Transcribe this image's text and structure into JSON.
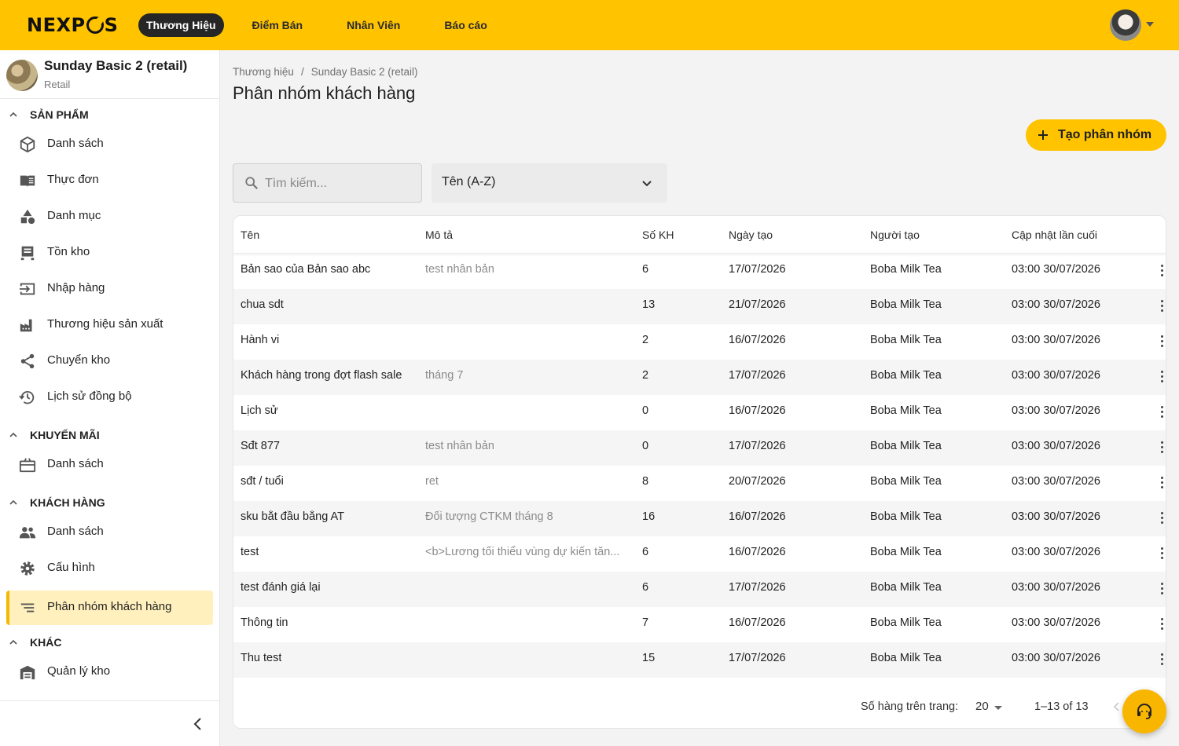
{
  "topbar": {
    "logo_text": "NEXPOS",
    "nav": [
      "Thương Hiệu",
      "Điểm Bán",
      "Nhân Viên",
      "Báo cáo"
    ],
    "active_nav_index": 0
  },
  "brand": {
    "name": "Sunday Basic 2 (retail)",
    "subtitle": "Retail"
  },
  "sidebar": {
    "sections": [
      {
        "title": "SẢN PHẨM",
        "items": [
          {
            "label": "Danh sách",
            "icon": "box-icon"
          },
          {
            "label": "Thực đơn",
            "icon": "menu-book-icon"
          },
          {
            "label": "Danh mục",
            "icon": "category-icon"
          },
          {
            "label": "Tồn kho",
            "icon": "inventory-icon"
          },
          {
            "label": "Nhập hàng",
            "icon": "import-icon"
          },
          {
            "label": "Thương hiệu sản xuất",
            "icon": "factory-icon"
          },
          {
            "label": "Chuyển kho",
            "icon": "share-icon"
          },
          {
            "label": "Lịch sử đồng bộ",
            "icon": "history-icon"
          }
        ]
      },
      {
        "title": "KHUYẾN MÃI",
        "items": [
          {
            "label": "Danh sách",
            "icon": "gift-card-icon"
          }
        ]
      },
      {
        "title": "KHÁCH HÀNG",
        "items": [
          {
            "label": "Danh sách",
            "icon": "people-icon"
          },
          {
            "label": "Cấu hình",
            "icon": "gear-icon"
          },
          {
            "label": "Phân nhóm khách hàng",
            "icon": "segment-icon",
            "active": true
          }
        ]
      },
      {
        "title": "KHÁC",
        "items": [
          {
            "label": "Quản lý kho",
            "icon": "warehouse-icon"
          }
        ]
      }
    ]
  },
  "breadcrumb": [
    "Thương hiệu",
    "Sunday Basic 2 (retail)"
  ],
  "page_title": "Phân nhóm khách hàng",
  "create_button": "Tạo phân nhóm",
  "search": {
    "placeholder": "Tìm kiếm...",
    "value": ""
  },
  "sort": {
    "selected": "Tên (A-Z)"
  },
  "table": {
    "columns": [
      "Tên",
      "Mô tả",
      "Số KH",
      "Ngày tạo",
      "Người tạo",
      "Cập nhật lần cuối"
    ],
    "rows": [
      [
        "Bản sao của Bản sao abc",
        "test nhân bản",
        "6",
        "17/07/2026",
        "Boba Milk Tea",
        "03:00 30/07/2026"
      ],
      [
        "chua sdt",
        "",
        "13",
        "21/07/2026",
        "Boba Milk Tea",
        "03:00 30/07/2026"
      ],
      [
        "Hành vi",
        "",
        "2",
        "16/07/2026",
        "Boba Milk Tea",
        "03:00 30/07/2026"
      ],
      [
        "Khách hàng trong đợt flash sale",
        "tháng 7",
        "2",
        "17/07/2026",
        "Boba Milk Tea",
        "03:00 30/07/2026"
      ],
      [
        "Lịch sử",
        "",
        "0",
        "16/07/2026",
        "Boba Milk Tea",
        "03:00 30/07/2026"
      ],
      [
        "Sđt 877",
        "test nhân bản",
        "0",
        "17/07/2026",
        "Boba Milk Tea",
        "03:00 30/07/2026"
      ],
      [
        "sđt / tuổi",
        "ret",
        "8",
        "20/07/2026",
        "Boba Milk Tea",
        "03:00 30/07/2026"
      ],
      [
        "sku bắt đầu bằng AT",
        "Đối tượng CTKM tháng 8",
        "16",
        "16/07/2026",
        "Boba Milk Tea",
        "03:00 30/07/2026"
      ],
      [
        "test",
        "<b>Lương tối thiểu vùng dự kiến tăn...",
        "6",
        "16/07/2026",
        "Boba Milk Tea",
        "03:00 30/07/2026"
      ],
      [
        "test đánh giá lại",
        "",
        "6",
        "17/07/2026",
        "Boba Milk Tea",
        "03:00 30/07/2026"
      ],
      [
        "Thông tin",
        "",
        "7",
        "16/07/2026",
        "Boba Milk Tea",
        "03:00 30/07/2026"
      ],
      [
        "Thu test",
        "",
        "15",
        "17/07/2026",
        "Boba Milk Tea",
        "03:00 30/07/2026"
      ]
    ]
  },
  "pagination": {
    "rows_per_page_label": "Số hàng trên trang:",
    "rows_per_page": "20",
    "range": "1–13 of 13"
  },
  "colors": {
    "brand_yellow": "#ffc300",
    "active_bg": "#fff0bd",
    "dark_pill": "#262626"
  }
}
